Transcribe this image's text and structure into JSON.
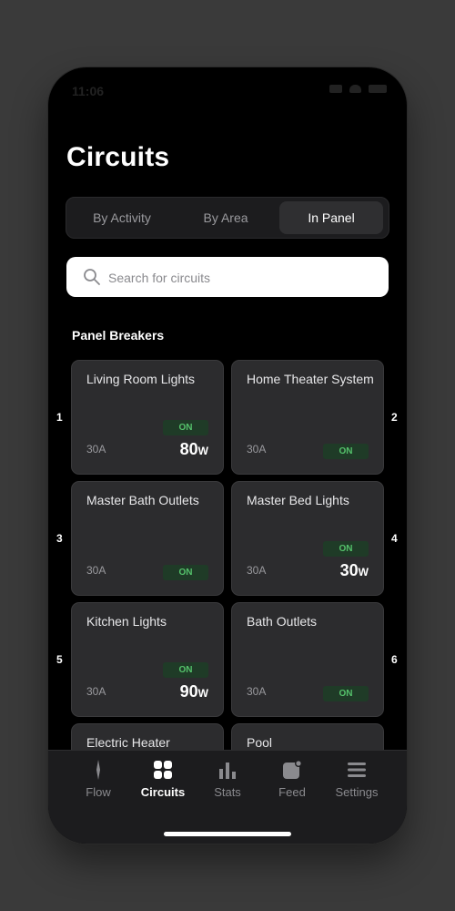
{
  "status": {
    "time": "11:06"
  },
  "header": {
    "title": "Circuits"
  },
  "segments": [
    {
      "label": "By Activity",
      "active": false
    },
    {
      "label": "By Area",
      "active": false
    },
    {
      "label": "In Panel",
      "active": true
    }
  ],
  "search": {
    "placeholder": "Search for circuits"
  },
  "section": {
    "label": "Panel Breakers"
  },
  "rows": [
    "1",
    "2",
    "3",
    "4",
    "5",
    "6"
  ],
  "circuits": [
    {
      "name": "Living Room Lights",
      "amps": "30A",
      "status": "ON",
      "watts": "80",
      "unit": "W"
    },
    {
      "name": "Home Theater System",
      "amps": "30A",
      "status": "ON",
      "watts": "",
      "unit": ""
    },
    {
      "name": "Master Bath Outlets",
      "amps": "30A",
      "status": "ON",
      "watts": "",
      "unit": ""
    },
    {
      "name": "Master Bed Lights",
      "amps": "30A",
      "status": "ON",
      "watts": "30",
      "unit": "W"
    },
    {
      "name": "Kitchen Lights",
      "amps": "30A",
      "status": "ON",
      "watts": "90",
      "unit": "W"
    },
    {
      "name": "Bath Outlets",
      "amps": "30A",
      "status": "ON",
      "watts": "",
      "unit": ""
    },
    {
      "name": "Electric Heater",
      "amps": "",
      "status": "",
      "watts": "",
      "unit": ""
    },
    {
      "name": "Pool",
      "amps": "",
      "status": "",
      "watts": "",
      "unit": ""
    }
  ],
  "tabs": [
    {
      "label": "Flow",
      "icon": "flow-icon",
      "active": false
    },
    {
      "label": "Circuits",
      "icon": "circuits-icon",
      "active": true
    },
    {
      "label": "Stats",
      "icon": "stats-icon",
      "active": false
    },
    {
      "label": "Feed",
      "icon": "feed-icon",
      "active": false
    },
    {
      "label": "Settings",
      "icon": "settings-icon",
      "active": false
    }
  ],
  "colors": {
    "accent_on": "#55c26b",
    "badge_bg": "#1f3b27",
    "card_bg": "#2c2c2e"
  }
}
